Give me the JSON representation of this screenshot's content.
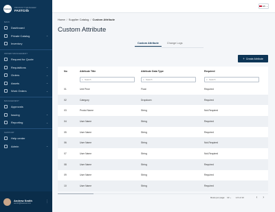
{
  "brand": {
    "subtitle": "PRODUCT MANAGER",
    "name": "FASTCrib",
    "logo_text": "Fastenal"
  },
  "sidebar": {
    "sections": [
      {
        "title": "MAIN",
        "items": [
          {
            "label": "Dashboard",
            "chevron": false
          },
          {
            "label": "Private Catalog",
            "chevron": true
          },
          {
            "label": "Inventory",
            "chevron": false
          }
        ]
      },
      {
        "title": "ORDER MANAGEMENT",
        "items": [
          {
            "label": "Request for Quote",
            "chevron": false
          },
          {
            "label": "Requisitions",
            "chevron": true
          },
          {
            "label": "Orders",
            "chevron": true
          },
          {
            "label": "Assets",
            "chevron": true
          },
          {
            "label": "Work Orders",
            "chevron": true
          }
        ]
      },
      {
        "title": "MANAGEMENT",
        "items": [
          {
            "label": "Approvals",
            "chevron": false
          },
          {
            "label": "Issuing",
            "chevron": true
          },
          {
            "label": "Reporting",
            "chevron": true
          }
        ]
      },
      {
        "title": "SUPPORT",
        "items": [
          {
            "label": "Help center",
            "chevron": false
          },
          {
            "label": "Admin",
            "chevron": true
          }
        ]
      }
    ],
    "chevron_glyph": "⌄"
  },
  "user": {
    "name": "Andrew Smith",
    "email": "asmith@fastenal.com",
    "menu": "⋮"
  },
  "topbar": {
    "lang": "EN",
    "lang_caret": "⌄"
  },
  "breadcrumb": {
    "home": "Home",
    "parent": "Supplier Catalog",
    "current": "Custom Attribute",
    "sep": "/"
  },
  "page": {
    "title": "Custom Attribute"
  },
  "tabs": [
    {
      "label": "Custom Attribute",
      "active": true
    },
    {
      "label": "Change Logs",
      "active": false
    }
  ],
  "create_button": {
    "label": "Create Attribute",
    "icon": "+"
  },
  "table": {
    "headers": [
      "No",
      "Attribute Title",
      "Attribute Data Type",
      "Required"
    ],
    "search_placeholder": "Search",
    "rows": [
      [
        "01",
        "Unit Price",
        "Float",
        "Required"
      ],
      [
        "02",
        "Category",
        "Dropdown",
        "Required"
      ],
      [
        "03",
        "Produt Name",
        "String",
        "Not-Required"
      ],
      [
        "04",
        "User Name",
        "String",
        "Required"
      ],
      [
        "05",
        "User Name",
        "String",
        "Required"
      ],
      [
        "06",
        "User Name",
        "String",
        "Not-Required"
      ],
      [
        "07",
        "User Name",
        "String",
        "Not-Required"
      ],
      [
        "08",
        "User Name",
        "String",
        "Required"
      ],
      [
        "09",
        "User Name",
        "String",
        "Required"
      ],
      [
        "10",
        "User Name",
        "String",
        "Required"
      ]
    ]
  },
  "pagination": {
    "rows_per_page_label": "Rows per page:",
    "rows_per_page": "10",
    "range": "1-5 of 13",
    "prev": "‹",
    "next": "›"
  },
  "colors": {
    "sidebar": "#0d3556",
    "accent": "#0d3556"
  }
}
